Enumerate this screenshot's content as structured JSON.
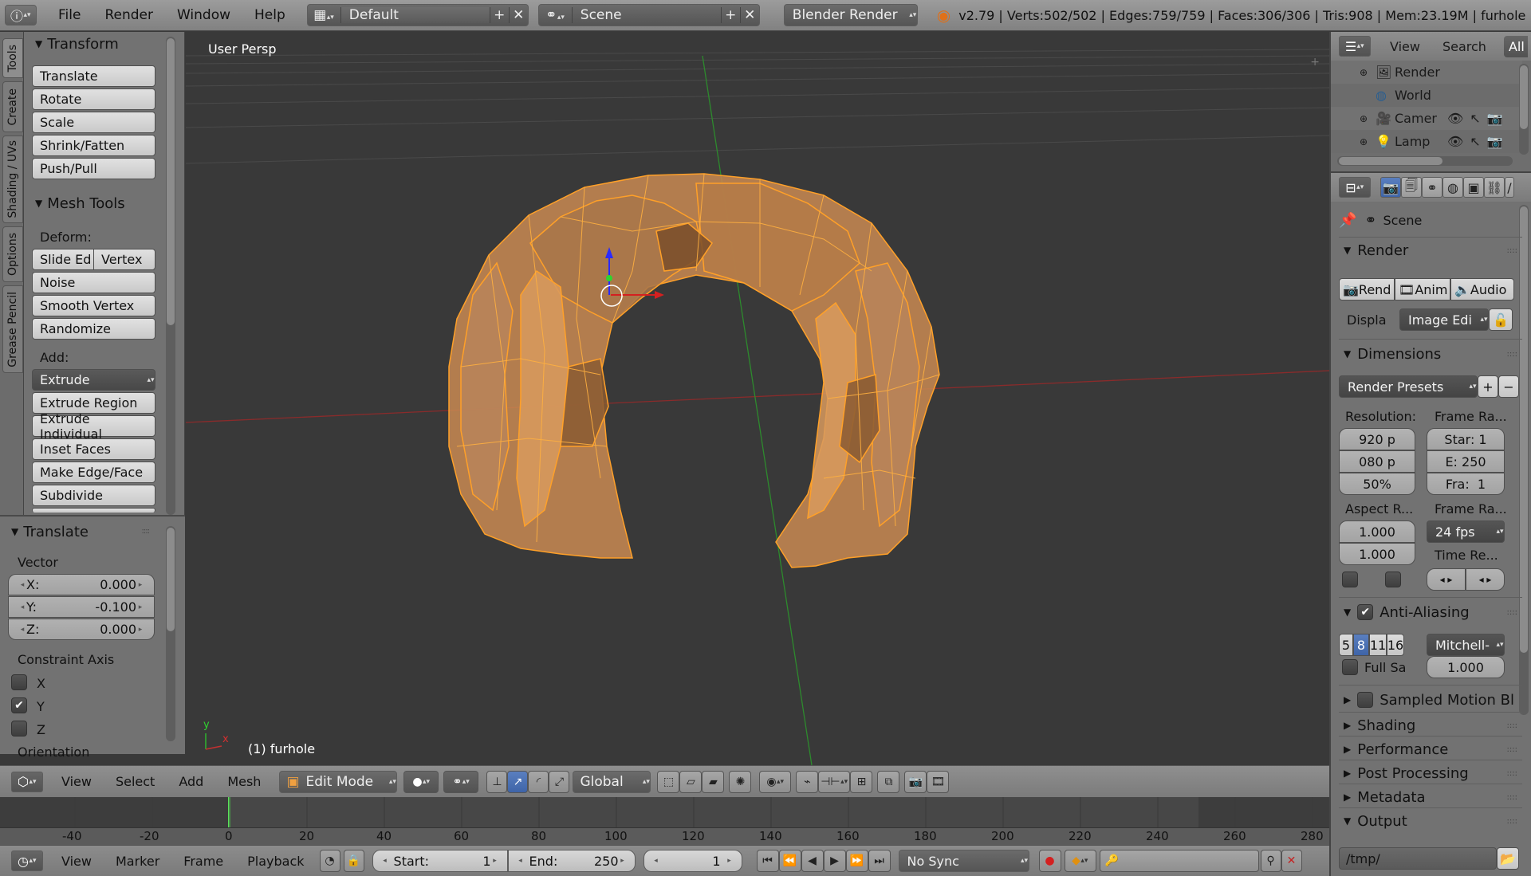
{
  "topbar": {
    "menus": [
      "File",
      "Render",
      "Window",
      "Help"
    ],
    "layout_name": "Default",
    "scene_name": "Scene",
    "render_engine": "Blender Render",
    "stats": "v2.79 | Verts:502/502 | Edges:759/759 | Faces:306/306 | Tris:908 | Mem:23.19M | furhole"
  },
  "left_tabs": [
    "Tools",
    "Create",
    "Shading / UVs",
    "Options",
    "Grease Pencil"
  ],
  "tools": {
    "transform_title": "Transform",
    "transform_buttons": [
      "Translate",
      "Rotate",
      "Scale",
      "Shrink/Fatten",
      "Push/Pull"
    ],
    "mesh_tools_title": "Mesh Tools",
    "deform_label": "Deform:",
    "slide_edge": "Slide Ed",
    "vertex": "Vertex",
    "deform_buttons": [
      "Noise",
      "Smooth Vertex",
      "Randomize"
    ],
    "add_label": "Add:",
    "extrude": "Extrude",
    "add_buttons": [
      "Extrude Region",
      "Extrude Individual",
      "Inset Faces",
      "Make Edge/Face",
      "Subdivide"
    ]
  },
  "operator": {
    "title": "Translate",
    "vector_label": "Vector",
    "x_label": "X:",
    "x": "0.000",
    "y_label": "Y:",
    "y": "-0.100",
    "z_label": "Z:",
    "z": "0.000",
    "constraint_label": "Constraint Axis",
    "axes": [
      {
        "label": "X",
        "checked": false
      },
      {
        "label": "Y",
        "checked": true
      },
      {
        "label": "Z",
        "checked": false
      }
    ],
    "orientation_label": "Orientation"
  },
  "viewport": {
    "persp_label": "User Persp",
    "object_label": "(1) furhole",
    "mesh_color": "#e8973a",
    "axis_y": "y",
    "axis_x": "x"
  },
  "view_header": {
    "menus": [
      "View",
      "Select",
      "Add",
      "Mesh"
    ],
    "mode": "Edit Mode",
    "orientation": "Global"
  },
  "timeline": {
    "ticks": [
      "-40",
      "-20",
      "0",
      "20",
      "40",
      "60",
      "80",
      "100",
      "120",
      "140",
      "160",
      "180",
      "200",
      "220",
      "240",
      "260",
      "280"
    ],
    "current_frame_marker": 0,
    "menus": [
      "View",
      "Marker",
      "Frame",
      "Playback"
    ],
    "start_label": "Start:",
    "start": "1",
    "end_label": "End:",
    "end": "250",
    "current": "1",
    "sync": "No Sync"
  },
  "outliner": {
    "menus": [
      "View",
      "Search",
      "All S"
    ],
    "items": [
      "Render",
      "World",
      "Camera",
      "Lamp"
    ]
  },
  "properties": {
    "scene_label": "Scene",
    "render_title": "Render",
    "render_buttons": [
      "Rend",
      "Anim",
      "Audio"
    ],
    "display_label": "Displa",
    "display_value": "Image Edi",
    "dimensions_title": "Dimensions",
    "presets": "Render Presets",
    "resolution_label": "Resolution:",
    "res_x": "920 p",
    "res_y": "080 p",
    "res_pct": "50%",
    "frame_range_label": "Frame Ra...",
    "frame_start": "Star: 1",
    "frame_end": "E: 250",
    "frame_step": "Fra:  1",
    "aspect_label": "Aspect R...",
    "aspect_x": "1.000",
    "aspect_y": "1.000",
    "frame_rate_label": "Frame Ra...",
    "fps": "24 fps",
    "time_remap_label": "Time Re...",
    "antialias_title": "Anti-Aliasing",
    "aa_samples": [
      "5",
      "8",
      "11",
      "16"
    ],
    "aa_selected": "8",
    "aa_filter": "Mitchell-",
    "full_sample": "Full Sa",
    "aa_size": "1.000",
    "collapsed_panels": [
      "Sampled Motion Bl",
      "Shading",
      "Performance",
      "Post Processing",
      "Metadata"
    ],
    "output_title": "Output",
    "output_path": "/tmp/"
  }
}
